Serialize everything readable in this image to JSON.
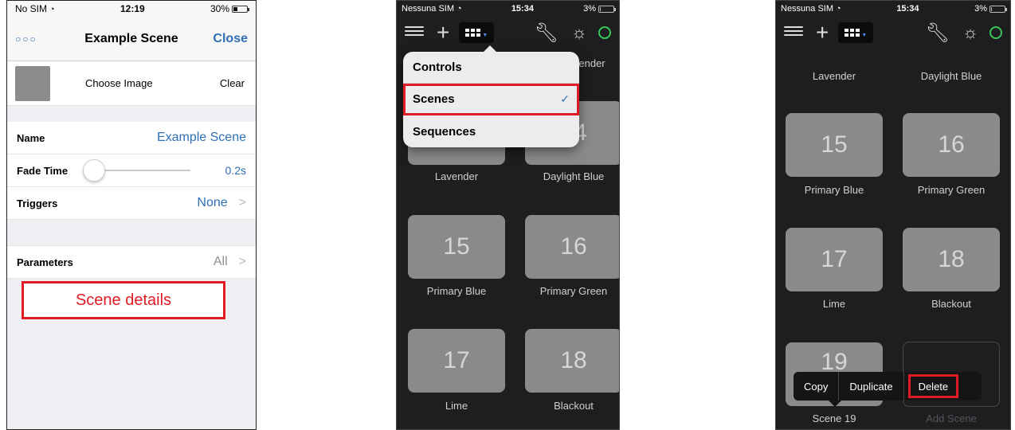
{
  "phone1": {
    "status": {
      "carrier": "No SIM",
      "time": "12:19",
      "battery": "30%",
      "battery_level": 0.3
    },
    "nav": {
      "menu": "○○○",
      "title": "Example Scene",
      "close": "Close"
    },
    "image_row": {
      "choose": "Choose Image",
      "clear": "Clear"
    },
    "name": {
      "label": "Name",
      "value": "Example Scene"
    },
    "fade": {
      "label": "Fade Time",
      "value": "0.2s",
      "level": 0.0
    },
    "triggers": {
      "label": "Triggers",
      "value": "None"
    },
    "parameters": {
      "label": "Parameters",
      "value": "All"
    },
    "annotation": "Scene details",
    "chevron": ">"
  },
  "phone2": {
    "status": {
      "carrier": "Nessuna SIM",
      "time": "15:34",
      "battery": "3%",
      "battery_level": 0.03
    },
    "menu": [
      {
        "label": "Controls"
      },
      {
        "label": "Scenes",
        "checked": true
      },
      {
        "label": "Sequences"
      }
    ],
    "check": "✓",
    "partial_label": "ender",
    "tiles": [
      {
        "label": "Lavender"
      },
      {
        "number": "14",
        "label": "Daylight Blue"
      },
      {
        "number": "15",
        "label": "Primary Blue"
      },
      {
        "number": "16",
        "label": "Primary Green"
      },
      {
        "number": "17",
        "label": "Lime"
      },
      {
        "number": "18",
        "label": "Blackout"
      }
    ]
  },
  "phone3": {
    "status": {
      "carrier": "Nessuna SIM",
      "time": "15:34",
      "battery": "3%",
      "battery_level": 0.03
    },
    "top_labels": [
      "Lavender",
      "Daylight Blue"
    ],
    "tiles": [
      {
        "number": "15",
        "label": "Primary Blue"
      },
      {
        "number": "16",
        "label": "Primary Green"
      },
      {
        "number": "17",
        "label": "Lime"
      },
      {
        "number": "18",
        "label": "Blackout"
      },
      {
        "number": "19",
        "label": "Scene 19"
      }
    ],
    "add_scene": "Add Scene",
    "context_menu": [
      "Copy",
      "Duplicate",
      "Delete"
    ]
  },
  "colors": {
    "accent": "#2f6fb5",
    "highlight": "#e01b24",
    "online": "#38c757"
  }
}
